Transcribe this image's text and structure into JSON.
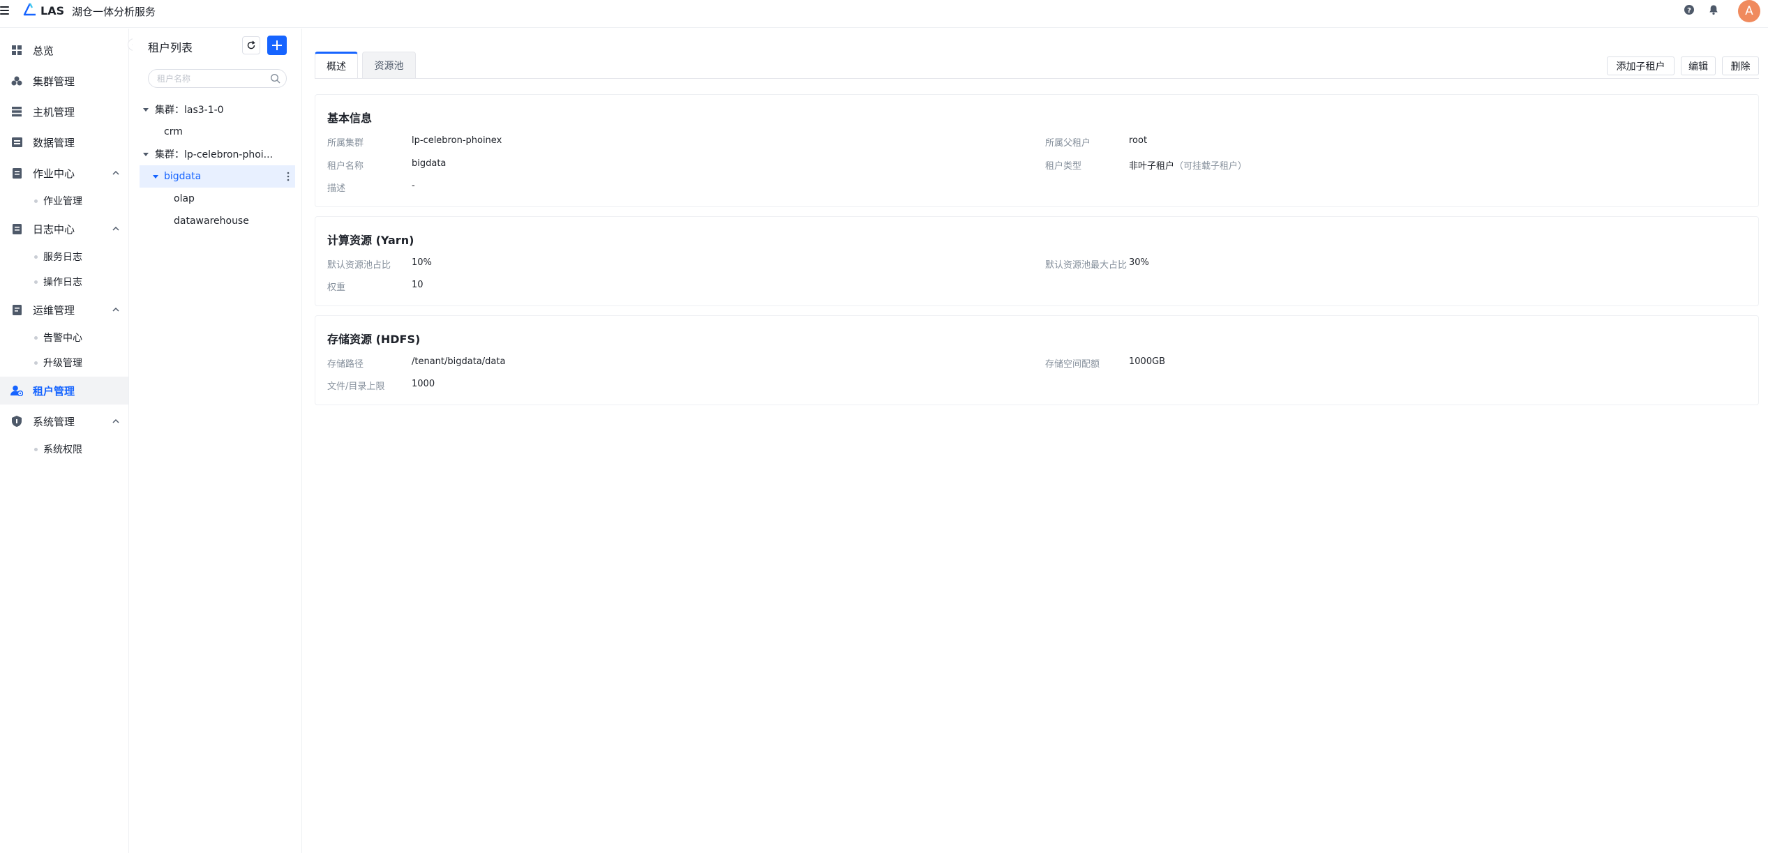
{
  "header": {
    "brand": "LAS",
    "service_name": "湖仓一体分析服务",
    "avatar_letter": "A",
    "accent_color": "#1664ff",
    "avatar_color": "#f08a5d"
  },
  "nav": {
    "overview": "总览",
    "cluster_mgmt": "集群管理",
    "host_mgmt": "主机管理",
    "data_mgmt": "数据管理",
    "job_center": "作业中心",
    "job_mgmt": "作业管理",
    "log_center": "日志中心",
    "service_log": "服务日志",
    "operation_log": "操作日志",
    "ops_mgmt": "运维管理",
    "alarm_center": "告警中心",
    "upgrade_mgmt": "升级管理",
    "tenant_mgmt": "租户管理",
    "system_mgmt": "系统管理",
    "system_permission": "系统权限"
  },
  "tenant_panel": {
    "title": "租户列表",
    "search_placeholder": "租户名称",
    "tree": [
      {
        "label": "集群：las3-1-0"
      },
      {
        "label": "crm"
      },
      {
        "label": "集群：lp-celebron-phoi..."
      },
      {
        "label": "bigdata"
      },
      {
        "label": "olap"
      },
      {
        "label": "datawarehouse"
      }
    ]
  },
  "main": {
    "tabs": [
      "概述",
      "资源池"
    ],
    "actions": {
      "add_child": "添加子租户",
      "edit": "编辑",
      "delete": "删除"
    },
    "basic": {
      "title": "基本信息",
      "cluster_label": "所属集群",
      "cluster_value": "lp-celebron-phoinex",
      "parent_label": "所属父租户",
      "parent_value": "root",
      "name_label": "租户名称",
      "name_value": "bigdata",
      "type_label": "租户类型",
      "type_value": "非叶子租户",
      "type_hint": "（可挂载子租户）",
      "desc_label": "描述",
      "desc_value": "-"
    },
    "compute": {
      "title": "计算资源 (Yarn)",
      "default_ratio_label": "默认资源池占比",
      "default_ratio_value": "10%",
      "max_ratio_label": "默认资源池最大占比",
      "max_ratio_value": "30%",
      "weight_label": "权重",
      "weight_value": "10"
    },
    "storage": {
      "title": "存储资源 (HDFS)",
      "path_label": "存储路径",
      "path_value": "/tenant/bigdata/data",
      "quota_label": "存储空间配额",
      "quota_value": "1000GB",
      "file_limit_label": "文件/目录上限",
      "file_limit_value": "1000"
    }
  }
}
